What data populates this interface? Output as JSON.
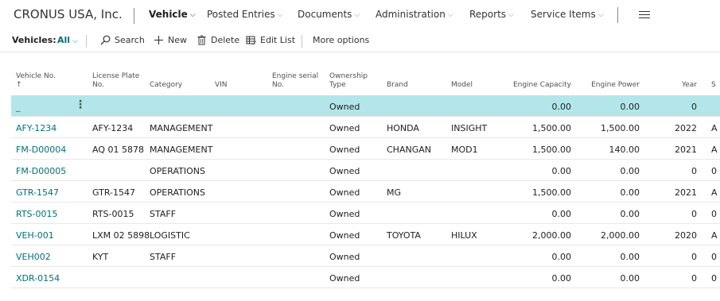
{
  "app": {
    "company": "CRONUS USA, Inc."
  },
  "nav": [
    {
      "label": "Vehicle",
      "active": true
    },
    {
      "label": "Posted Entries",
      "active": false
    },
    {
      "label": "Documents",
      "active": false
    },
    {
      "label": "Administration",
      "active": false
    },
    {
      "label": "Reports",
      "active": false
    },
    {
      "label": "Service Items",
      "active": false
    }
  ],
  "toolbar": {
    "title": "Vehicles:",
    "filter": "All",
    "search": "Search",
    "new": "New",
    "delete": "Delete",
    "edit_list": "Edit List",
    "more": "More options"
  },
  "columns": {
    "vehicle_no": "Vehicle No.",
    "sort_arrow": "↑",
    "license_1": "License Plate",
    "license_2": "No.",
    "category": "Category",
    "vin": "VIN",
    "engine_serial_1": "Engine serial",
    "engine_serial_2": "No.",
    "ownership_1": "Ownership",
    "ownership_2": "Type",
    "brand": "Brand",
    "model": "Model",
    "engine_capacity": "Engine Capacity",
    "engine_power": "Engine Power",
    "year": "Year",
    "next": "S"
  },
  "rows": [
    {
      "vehicle_no": "_",
      "license": "",
      "category": "",
      "ownership": "Owned",
      "brand": "",
      "model": "",
      "capacity": "0.00",
      "power": "0.00",
      "year": "0",
      "next": "",
      "selected": true
    },
    {
      "vehicle_no": "AFY-1234",
      "license": "AFY-1234",
      "category": "MANAGEMENT",
      "ownership": "Owned",
      "brand": "HONDA",
      "model": "INSIGHT",
      "capacity": "1,500.00",
      "power": "1,500.00",
      "year": "2022",
      "next": "A"
    },
    {
      "vehicle_no": "FM-D00004",
      "license": "AQ 01 5878",
      "category": "MANAGEMENT",
      "ownership": "Owned",
      "brand": "CHANGAN",
      "model": "MOD1",
      "capacity": "1,500.00",
      "power": "140.00",
      "year": "2021",
      "next": "A"
    },
    {
      "vehicle_no": "FM-D00005",
      "license": "",
      "category": "OPERATIONS",
      "ownership": "Owned",
      "brand": "",
      "model": "",
      "capacity": "0.00",
      "power": "0.00",
      "year": "0",
      "next": "0"
    },
    {
      "vehicle_no": "GTR-1547",
      "license": "GTR-1547",
      "category": "OPERATIONS",
      "ownership": "Owned",
      "brand": "MG",
      "model": "",
      "capacity": "1,500.00",
      "power": "0.00",
      "year": "2021",
      "next": "A"
    },
    {
      "vehicle_no": "RTS-0015",
      "license": "RTS-0015",
      "category": "STAFF",
      "ownership": "Owned",
      "brand": "",
      "model": "",
      "capacity": "0.00",
      "power": "0.00",
      "year": "0",
      "next": "0"
    },
    {
      "vehicle_no": "VEH-001",
      "license": "LXM 02 5898",
      "category": "LOGISTIC",
      "ownership": "Owned",
      "brand": "TOYOTA",
      "model": "HILUX",
      "capacity": "2,000.00",
      "power": "2,000.00",
      "year": "2020",
      "next": "A"
    },
    {
      "vehicle_no": "VEH002",
      "license": "KYT",
      "category": "STAFF",
      "ownership": "Owned",
      "brand": "",
      "model": "",
      "capacity": "0.00",
      "power": "0.00",
      "year": "0",
      "next": "0"
    },
    {
      "vehicle_no": "XDR-0154",
      "license": "",
      "category": "",
      "ownership": "Owned",
      "brand": "",
      "model": "",
      "capacity": "0.00",
      "power": "0.00",
      "year": "0",
      "next": "0"
    }
  ]
}
